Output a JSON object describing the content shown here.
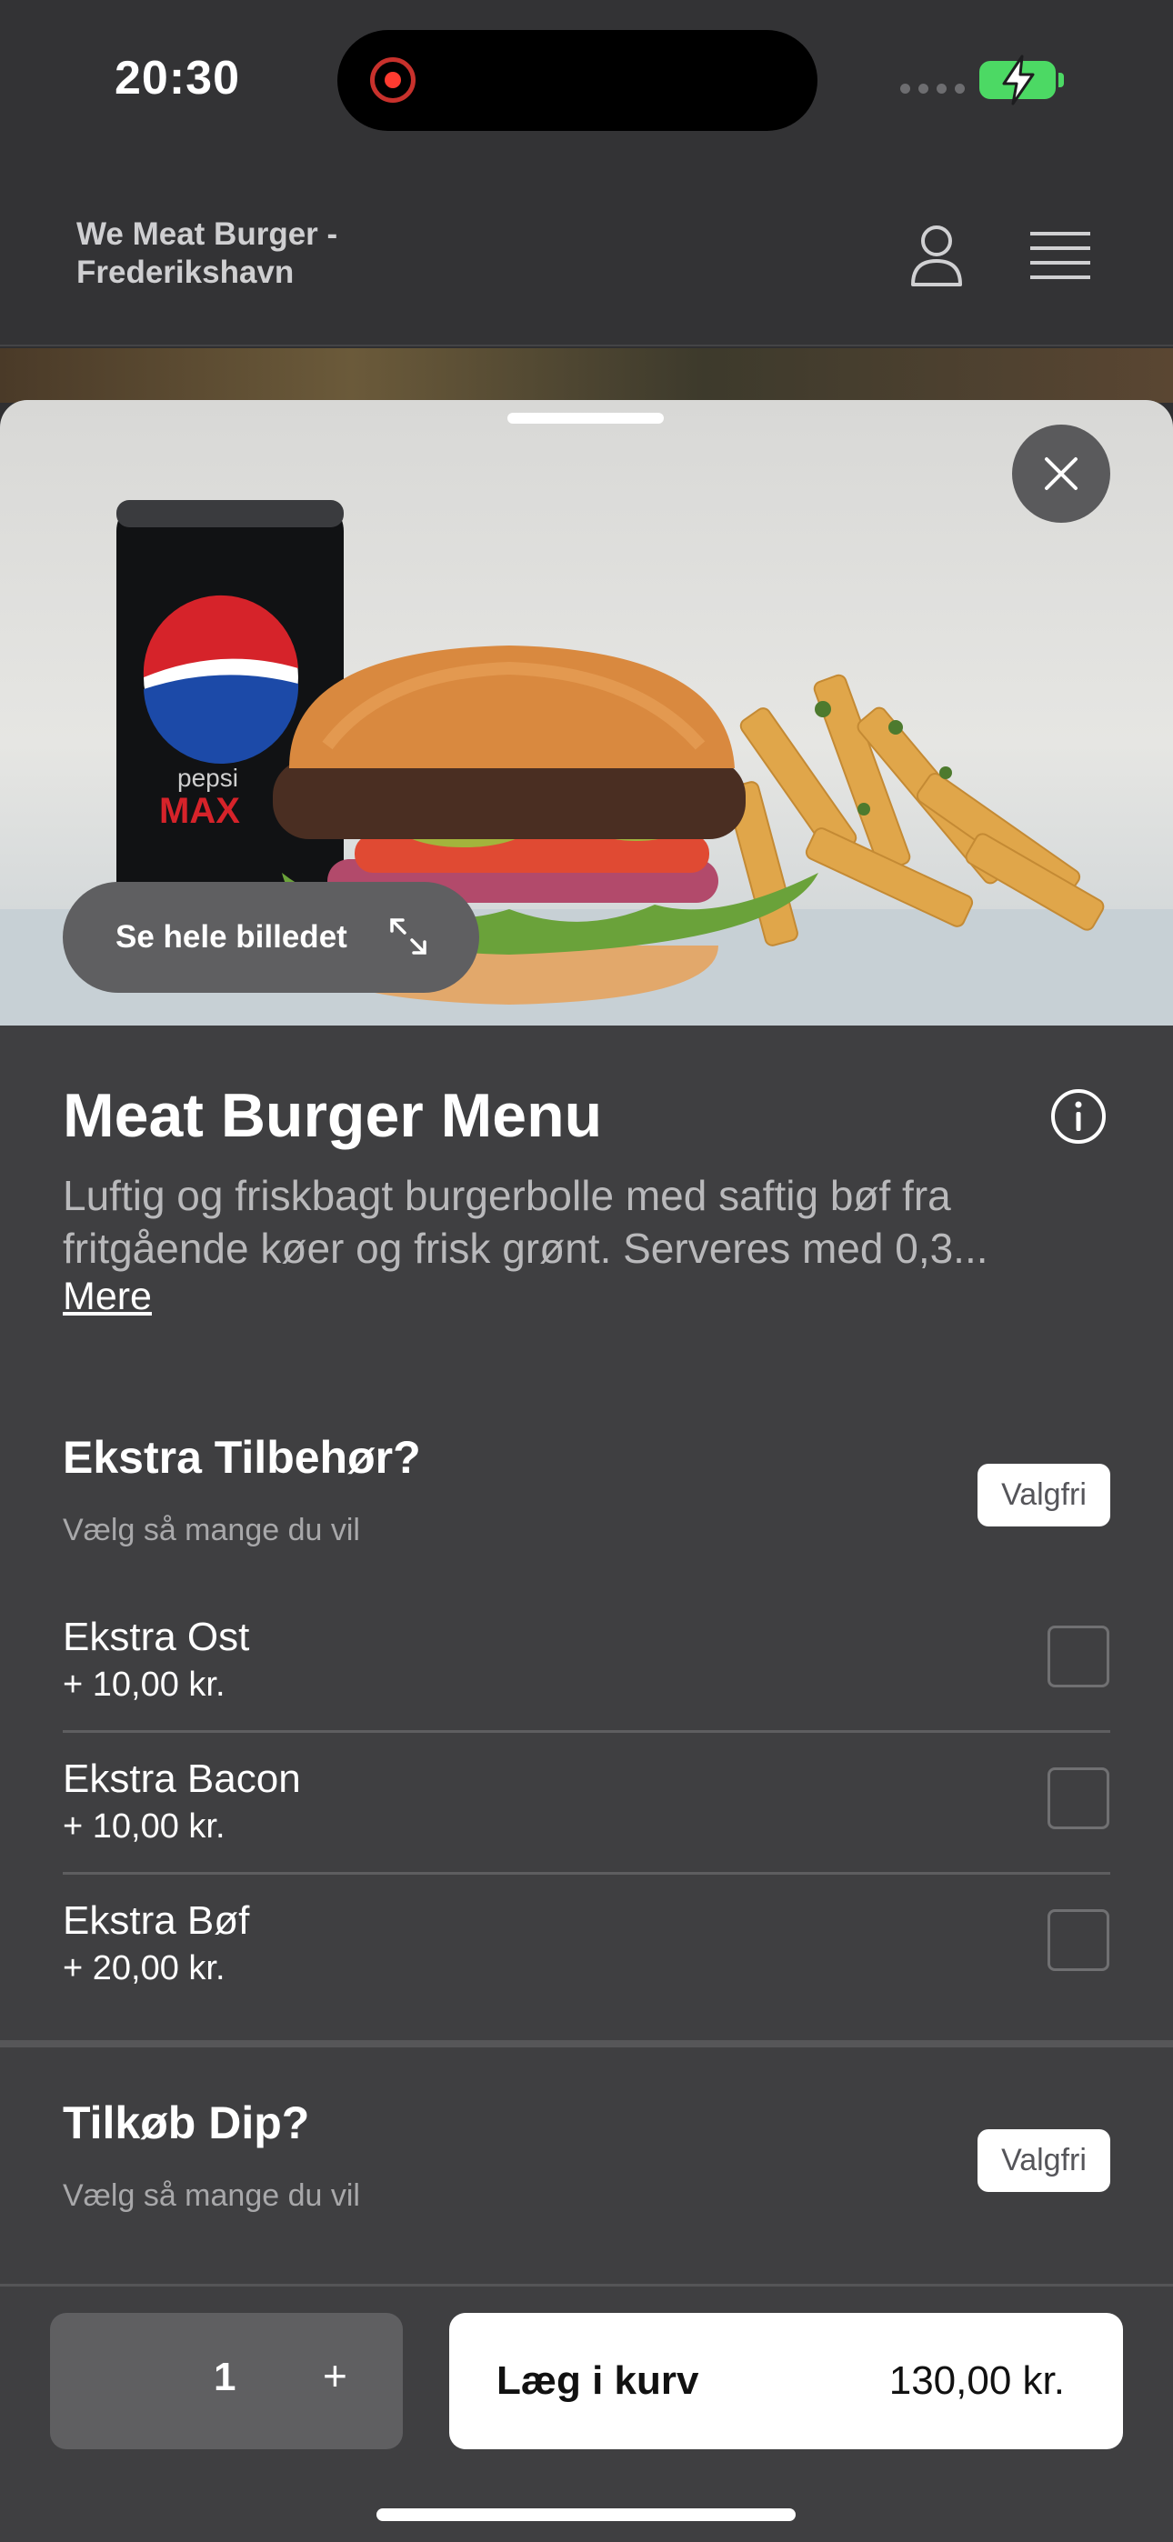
{
  "status_bar": {
    "time": "20:30"
  },
  "header": {
    "store_name": "We Meat Burger - Frederikshavn"
  },
  "product": {
    "see_image_label": "Se hele billedet",
    "title": "Meat Burger Menu",
    "description": "Luftig og friskbagt burgerbolle med saftig bøf fra fritgående køer og frisk grønt. Serveres med 0,3...",
    "more_label": "Mere"
  },
  "sections": [
    {
      "title": "Ekstra Tilbehør?",
      "subtitle": "Vælg så mange du vil",
      "badge": "Valgfri",
      "options": [
        {
          "name": "Ekstra Ost",
          "price": "+ 10,00 kr.",
          "checked": false
        },
        {
          "name": "Ekstra Bacon",
          "price": "+ 10,00 kr.",
          "checked": false
        },
        {
          "name": "Ekstra Bøf",
          "price": "+ 20,00 kr.",
          "checked": false
        }
      ]
    },
    {
      "title": "Tilkøb Dip?",
      "subtitle": "Vælg så mange du vil",
      "badge": "Valgfri",
      "options": []
    }
  ],
  "bottom_bar": {
    "quantity": "1",
    "plus": "+",
    "add_label": "Læg i kurv",
    "total": "130,00 kr."
  },
  "colors": {
    "accent": "#4cd964",
    "sheet": "#3f3f41",
    "button": "#ffffff"
  }
}
